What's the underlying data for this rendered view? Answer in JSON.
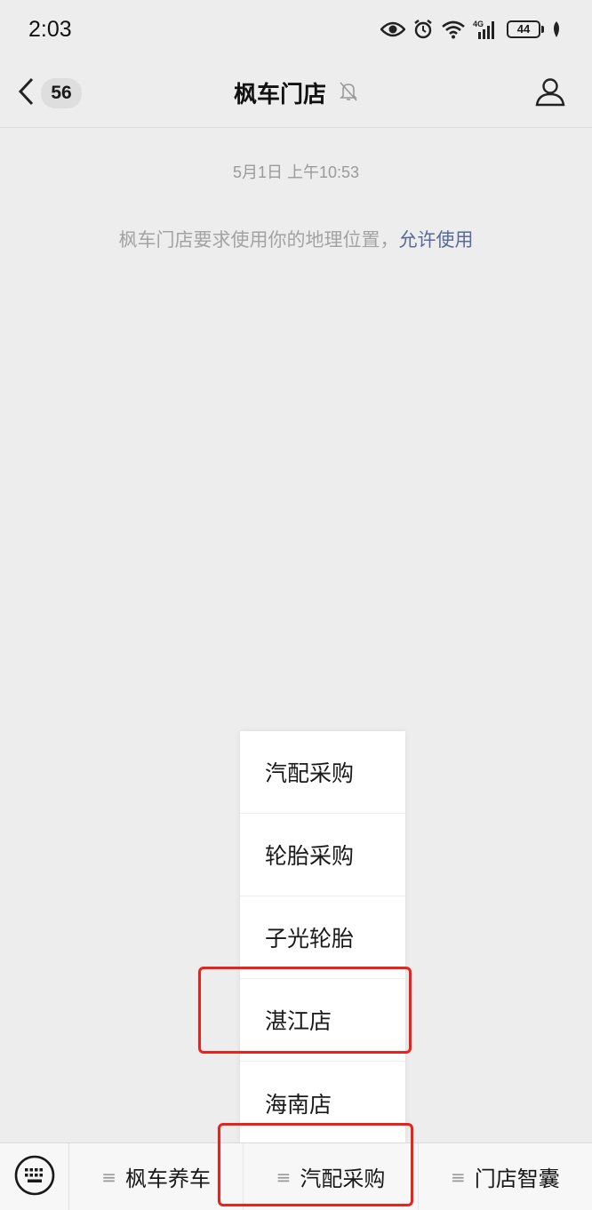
{
  "status_bar": {
    "time": "2:03",
    "network": "4G",
    "battery": "44"
  },
  "nav": {
    "unread_count": "56",
    "title": "枫车门店"
  },
  "chat": {
    "timestamp": "5月1日 上午10:53",
    "system_text": "枫车门店要求使用你的地理位置，",
    "allow_link": "允许使用"
  },
  "popup_menu": {
    "items": [
      "汽配采购",
      "轮胎采购",
      "子光轮胎",
      "湛江店",
      "海南店"
    ]
  },
  "bottom_menu": {
    "glyph": "≡",
    "tabs": [
      "枫车养车",
      "汽配采购",
      "门店智囊"
    ]
  },
  "colors": {
    "background": "#ededed",
    "link": "#576b95",
    "highlight": "#e8231c"
  }
}
